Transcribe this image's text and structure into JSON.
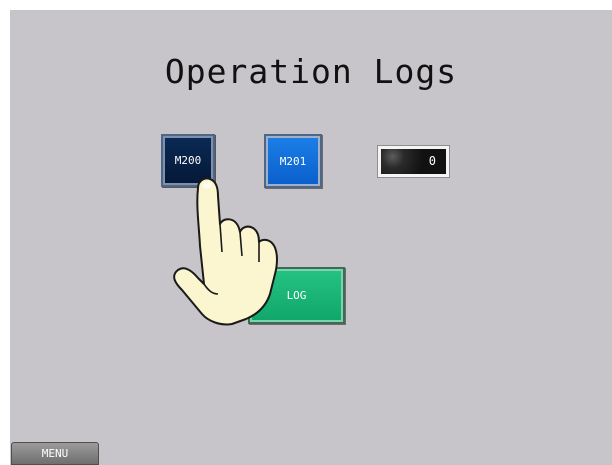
{
  "screen": {
    "title": "Operation Logs",
    "buttons": {
      "m200_label": "M200",
      "m201_label": "M201",
      "log_label": "LOG",
      "menu_label": "MENU"
    },
    "counter": {
      "value": "0"
    },
    "icons": {
      "pointer": "pointing-hand-icon"
    },
    "colors": {
      "background": "#c7c5c9",
      "m200": "#051837",
      "m201": "#0a5fcc",
      "log": "#10a66a"
    }
  }
}
